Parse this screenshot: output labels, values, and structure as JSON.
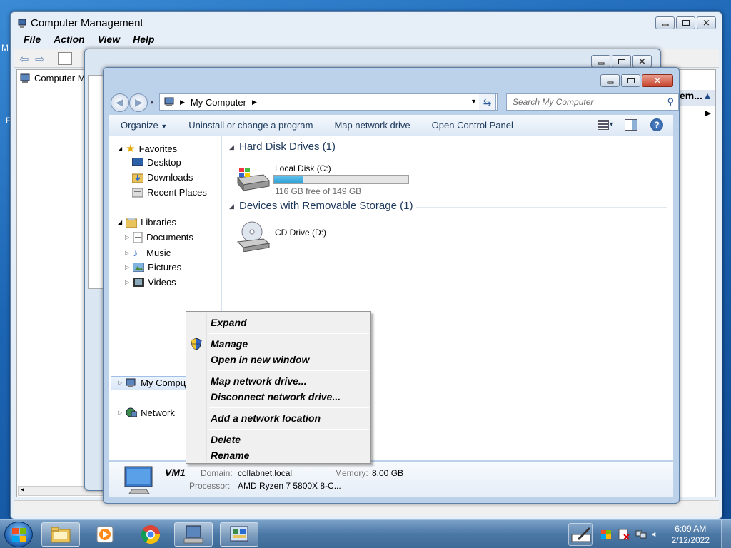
{
  "desktop": {
    "edge_letters": [
      "M",
      "F"
    ]
  },
  "computer_management": {
    "title": "Computer Management",
    "menu": [
      "File",
      "Action",
      "View",
      "Help"
    ],
    "tree_item": "Computer Ma",
    "right_pane_header": "em...",
    "right_pane_arrow": "▲"
  },
  "explorer": {
    "breadcrumb": "My Computer",
    "search_placeholder": "Search My Computer",
    "commands": [
      "Organize",
      "Uninstall or change a program",
      "Map network drive",
      "Open Control Panel"
    ],
    "nav": {
      "favorites": "Favorites",
      "desktop": "Desktop",
      "downloads": "Downloads",
      "recent_places": "Recent Places",
      "libraries": "Libraries",
      "documents": "Documents",
      "music": "Music",
      "pictures": "Pictures",
      "videos": "Videos",
      "my_computer": "My Computer",
      "network": "Network"
    },
    "groups": {
      "hard_disk": "Hard Disk Drives (1)",
      "removable": "Devices with Removable Storage (1)"
    },
    "local_disk": {
      "name": "Local Disk (C:)",
      "free_text": "116 GB free of 149 GB",
      "used_fraction": 0.22
    },
    "cd_drive": "CD Drive (D:)",
    "details": {
      "name": "VM1",
      "domain_label": "Domain:",
      "domain_value": "collabnet.local",
      "memory_label": "Memory:",
      "memory_value": "8.00 GB",
      "processor_label": "Processor:",
      "processor_value": "AMD Ryzen 7 5800X 8-C..."
    }
  },
  "context_menu": {
    "expand": "Expand",
    "manage": "Manage",
    "open_new_window": "Open in new window",
    "map_network_drive": "Map network drive...",
    "disconnect_network_drive": "Disconnect network drive...",
    "add_network_location": "Add a network location",
    "delete": "Delete",
    "rename": "Rename"
  },
  "taskbar": {
    "time": "6:09 AM",
    "date": "2/12/2022"
  },
  "colors": {
    "disk_bar": "#2aa0d6",
    "accent": "#1e395b"
  }
}
